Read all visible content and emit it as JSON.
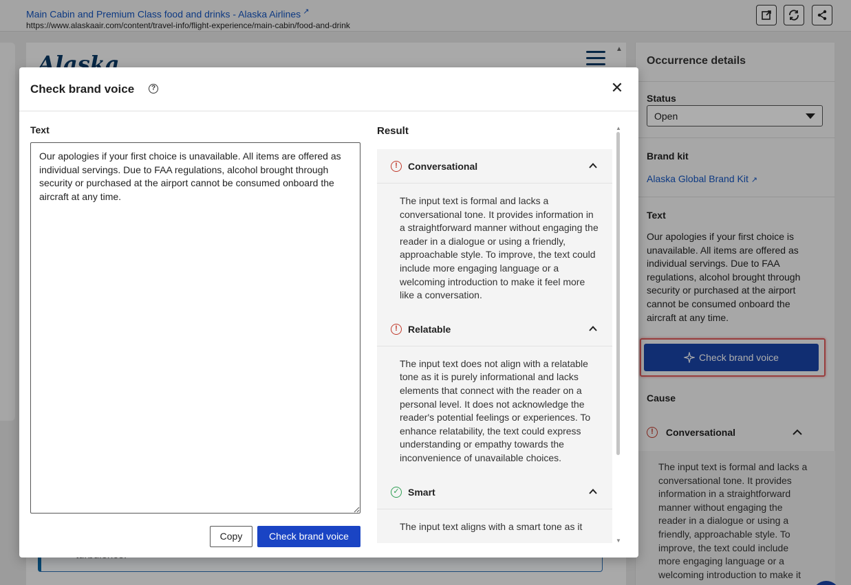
{
  "browser": {
    "page_title": "Main Cabin and Premium Class food and drinks - Alaska Airlines",
    "url": "https://www.alaskaair.com/content/travel-info/flight-experience/main-cabin/food-and-drink",
    "external_link_icon": "external-link-icon",
    "toolbar_icons": [
      "open-in-new-icon",
      "refresh-icon",
      "share-icon"
    ]
  },
  "background": {
    "logo_text": "Alaska",
    "notice_text": "turbulence."
  },
  "occurrence": {
    "title": "Occurrence details",
    "status_label": "Status",
    "status_value": "Open",
    "brand_kit_label": "Brand kit",
    "brand_kit_link": "Alaska Global Brand Kit",
    "text_label": "Text",
    "text_value": "Our apologies if your first choice is unavailable. All items are offered as individual servings. Due to FAA regulations, alcohol brought through security or purchased at the airport cannot be consumed onboard the aircraft at any time.",
    "check_button": "Check brand voice",
    "cause_label": "Cause",
    "cause_item": "Conversational",
    "cause_body": "The input text is formal and lacks a conversational tone. It provides information in a straightforward manner without engaging the reader in a dialogue or using a friendly, approachable style. To improve, the text could include more engaging language or a welcoming introduction to make it"
  },
  "modal": {
    "title": "Check brand voice",
    "text_label": "Text",
    "text_value": "Our apologies if your first choice is unavailable. All items are offered as individual servings. Due to FAA regulations, alcohol brought through security or purchased at the airport cannot be consumed onboard the aircraft at any time.",
    "copy_button": "Copy",
    "check_button": "Check brand voice",
    "result_label": "Result",
    "results": [
      {
        "name": "Conversational",
        "status": "warning",
        "body": "The input text is formal and lacks a conversational tone. It provides information in a straightforward manner without engaging the reader in a dialogue or using a friendly, approachable style. To improve, the text could include more engaging language or a welcoming introduction to make it feel more like a conversation."
      },
      {
        "name": "Relatable",
        "status": "warning",
        "body": "The input text does not align with a relatable tone as it is purely informational and lacks elements that connect with the reader on a personal level. It does not acknowledge the reader's potential feelings or experiences. To enhance relatability, the text could express understanding or empathy towards the inconvenience of unavailable choices."
      },
      {
        "name": "Smart",
        "status": "ok",
        "body": "The input text aligns with a smart tone as it"
      }
    ]
  },
  "colors": {
    "primary_button": "#1a44c4",
    "warning": "#c0392b",
    "success": "#2e9e53",
    "link": "#1455c0",
    "highlight": "#e05a5a"
  }
}
